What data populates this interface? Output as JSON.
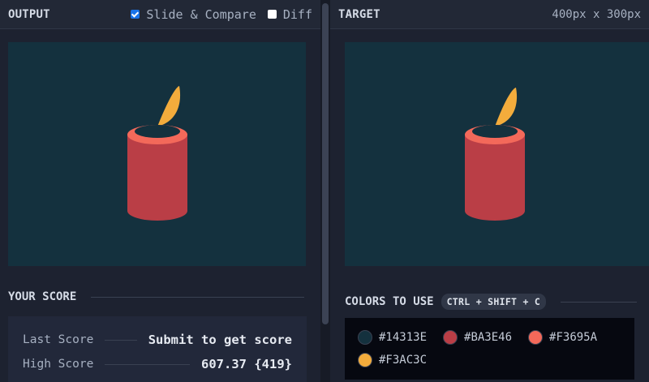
{
  "output": {
    "title": "OUTPUT",
    "slide_compare_label": "Slide & Compare",
    "diff_label": "Diff"
  },
  "target": {
    "title": "TARGET",
    "dimensions": "400px x 300px"
  },
  "score": {
    "title": "YOUR SCORE",
    "last_label": "Last Score",
    "last_value": "Submit to get score",
    "high_label": "High Score",
    "high_value": "607.37 {419}"
  },
  "colors_section": {
    "title": "COLORS TO USE",
    "shortcut": "CTRL + SHIFT + C",
    "colors": [
      "#14313E",
      "#BA3E46",
      "#F3695A",
      "#F3AC3C"
    ]
  }
}
